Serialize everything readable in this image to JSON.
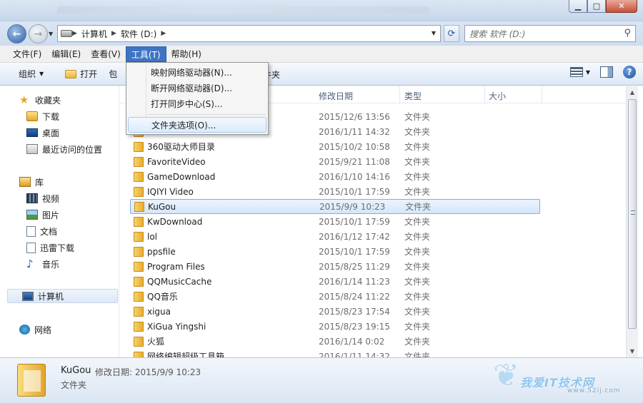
{
  "window": {
    "minimize": "▁",
    "maximize": "□",
    "close": "✕"
  },
  "address": {
    "breadcrumbs": [
      "计算机",
      "软件 (D:)"
    ],
    "search_placeholder": "搜索 软件 (D:)"
  },
  "menu": {
    "file": "文件(F)",
    "edit": "编辑(E)",
    "view": "查看(V)",
    "tools": "工具(T)",
    "help": "帮助(H)"
  },
  "toolbar": {
    "organize": "组织",
    "open": "打开",
    "include_partial": "包",
    "new_folder_partial": "件夹"
  },
  "tools_menu": {
    "items": [
      "映射网络驱动器(N)...",
      "断开网络驱动器(D)...",
      "打开同步中心(S)...",
      "文件夹选项(O)..."
    ]
  },
  "nav": {
    "favorites": "收藏夹",
    "downloads": "下载",
    "desktop": "桌面",
    "recent": "最近访问的位置",
    "libraries": "库",
    "videos": "视频",
    "pictures": "图片",
    "documents": "文档",
    "thunder": "迅雷下载",
    "music": "音乐",
    "computer": "计算机",
    "network": "网络"
  },
  "columns": {
    "date": "修改日期",
    "type": "类型",
    "size": "大小"
  },
  "files": [
    {
      "name": "",
      "date": "2015/12/6 13:56",
      "type": "文件夹"
    },
    {
      "name": "",
      "date": "2016/1/11 14:32",
      "type": "文件夹"
    },
    {
      "name": "360驱动大师目录",
      "date": "2015/10/2 10:58",
      "type": "文件夹"
    },
    {
      "name": "FavoriteVideo",
      "date": "2015/9/21 11:08",
      "type": "文件夹"
    },
    {
      "name": "GameDownload",
      "date": "2016/1/10 14:16",
      "type": "文件夹"
    },
    {
      "name": "IQIYI Video",
      "date": "2015/10/1 17:59",
      "type": "文件夹"
    },
    {
      "name": "KuGou",
      "date": "2015/9/9 10:23",
      "type": "文件夹"
    },
    {
      "name": "KwDownload",
      "date": "2015/10/1 17:59",
      "type": "文件夹"
    },
    {
      "name": "lol",
      "date": "2016/1/12 17:42",
      "type": "文件夹"
    },
    {
      "name": "ppsfile",
      "date": "2015/10/1 17:59",
      "type": "文件夹"
    },
    {
      "name": "Program Files",
      "date": "2015/8/25 11:29",
      "type": "文件夹"
    },
    {
      "name": "QQMusicCache",
      "date": "2016/1/14 11:23",
      "type": "文件夹"
    },
    {
      "name": "QQ音乐",
      "date": "2015/8/24 11:22",
      "type": "文件夹"
    },
    {
      "name": "xigua",
      "date": "2015/8/23 17:54",
      "type": "文件夹"
    },
    {
      "name": "XiGua Yingshi",
      "date": "2015/8/23 19:15",
      "type": "文件夹"
    },
    {
      "name": "火狐",
      "date": "2016/1/14 0:02",
      "type": "文件夹"
    },
    {
      "name": "网络编辑超级工具箱",
      "date": "2016/1/11 14:32",
      "type": "文件夹"
    }
  ],
  "details": {
    "name": "KuGou",
    "modified": "修改日期: 2015/9/9 10:23",
    "type": "文件夹"
  },
  "watermark": {
    "text": "我爱IT技术网",
    "url": "www.52ij.com"
  }
}
